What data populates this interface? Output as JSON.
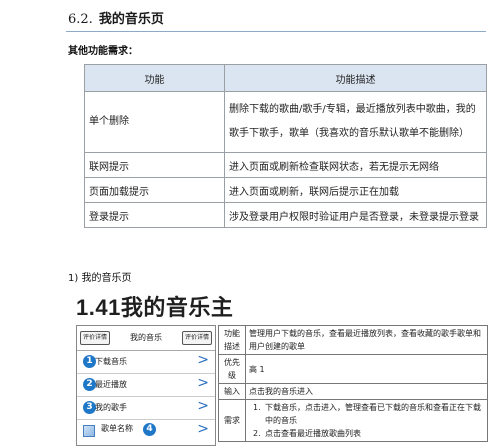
{
  "section": {
    "number": "6.2.",
    "title": "我的音乐页"
  },
  "subheading": "其他功能需求：",
  "requirements": {
    "headers": [
      "功能",
      "功能描述"
    ],
    "rows": [
      {
        "feature": "单个删除",
        "desc": "删除下载的歌曲/歌手/专辑，最近播放列表中歌曲，我的歌手下歌手，歌单（我喜欢的音乐默认歌单不能删除）"
      },
      {
        "feature": "联网提示",
        "desc": "进入页面或刷新检查联网状态，若无提示无网络"
      },
      {
        "feature": "页面加载提示",
        "desc": "进入页面或刷新，联网后提示正在加载"
      },
      {
        "feature": "登录提示",
        "desc": "涉及登录用户权限时验证用户是否登录，未登录提示登录"
      }
    ]
  },
  "list_item": "1)  我的音乐页",
  "big_title": "1.41我的音乐主",
  "phone": {
    "left_button": "评价详情",
    "title": "我的音乐",
    "right_button": "评价详情",
    "rows": [
      {
        "num": "1",
        "label": "下载音乐"
      },
      {
        "num": "2",
        "label": "最近播放"
      },
      {
        "num": "3",
        "label": "我的歌手"
      }
    ],
    "song_label": "歌单名称",
    "song_num": "4",
    "song_sub": "我也喜欢的歌单"
  },
  "detail": {
    "rows": [
      {
        "key": "功能描述",
        "value": "管理用户下载的音乐，查看最近播放列表，查看收藏的歌手歌单和用户创建的歌单"
      },
      {
        "key": "优先级",
        "value": "高 1"
      },
      {
        "key": "输入",
        "value": "点击我的音乐进入"
      },
      {
        "key": "需求",
        "items": [
          "下载音乐，点击进入，管理查看已下载的音乐和查看正在下载中的音乐",
          "点击查看最近播放歌曲列表"
        ]
      }
    ]
  }
}
